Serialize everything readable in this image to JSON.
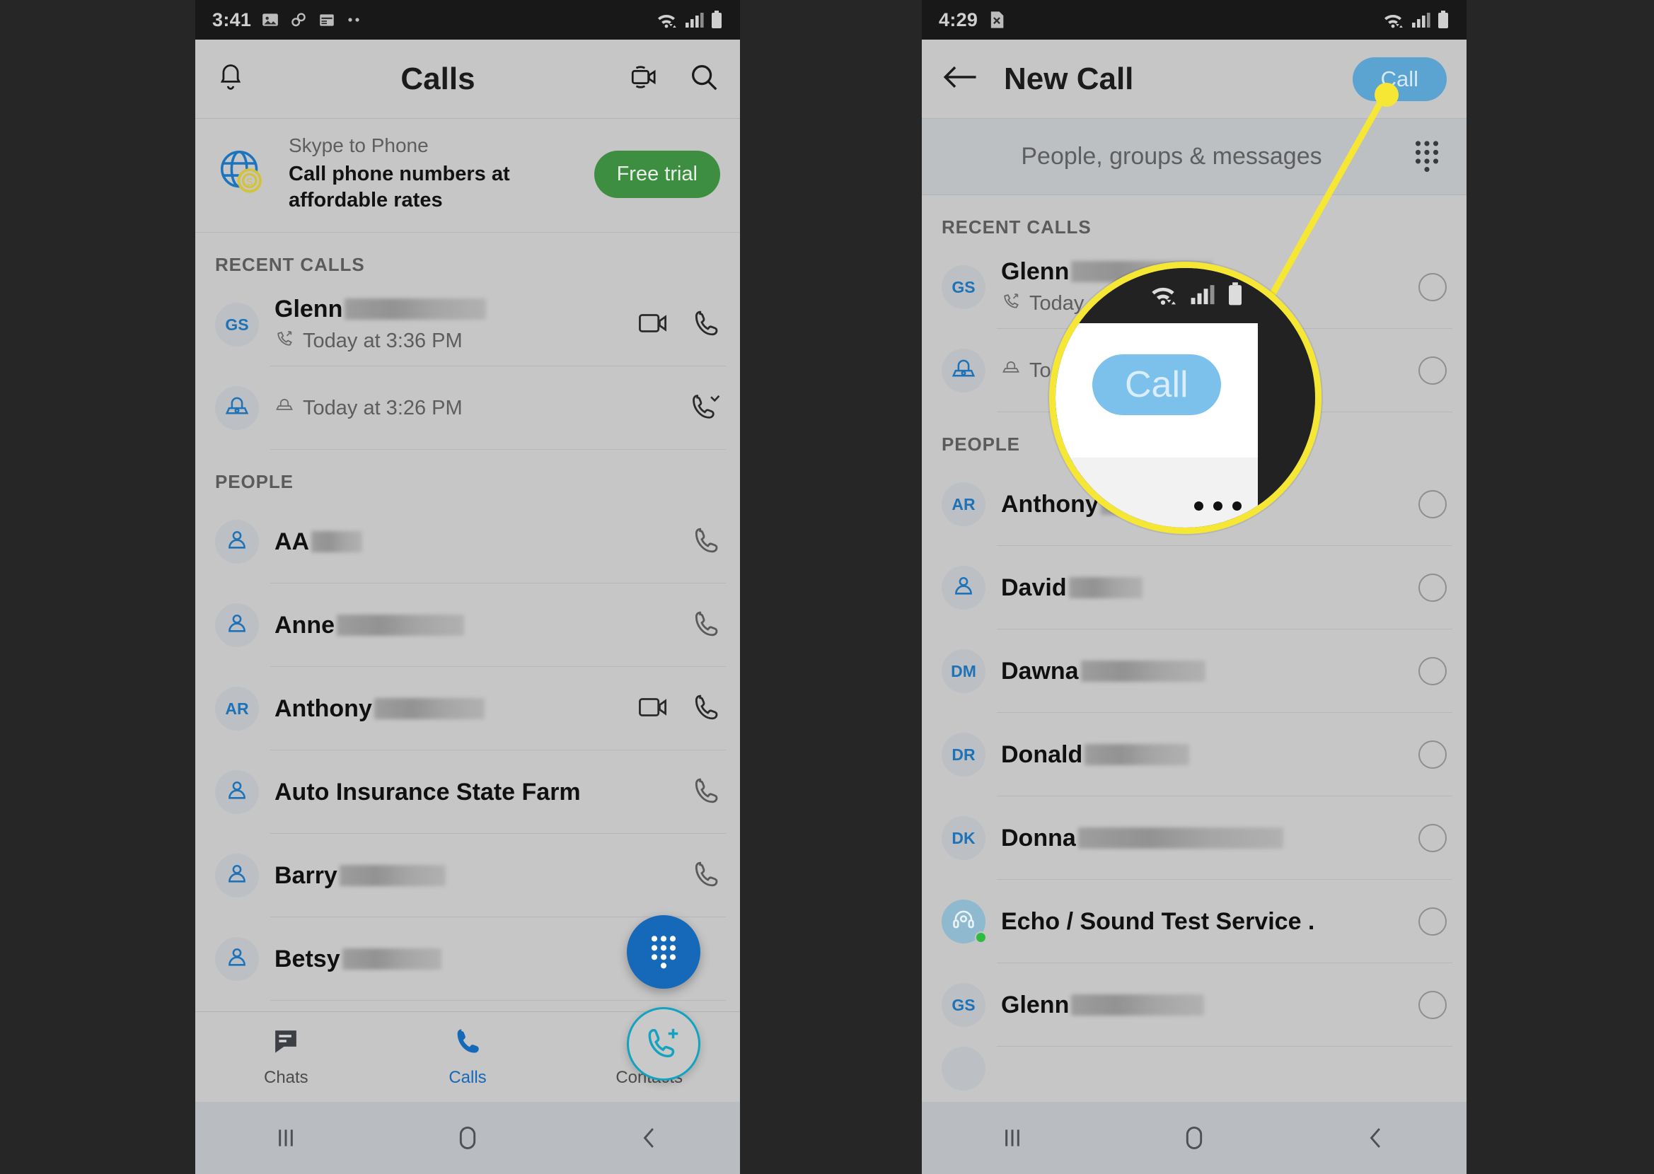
{
  "background_color": "#262626",
  "left_phone": {
    "status_bar": {
      "time": "3:41",
      "icons": [
        "photo-icon",
        "link-icon",
        "calendar-icon",
        "more-dots-icon",
        "wifi-icon",
        "signal-icon",
        "battery-icon"
      ]
    },
    "app_bar": {
      "title": "Calls",
      "bell_icon": "bell-icon",
      "video_icon": "video-camera-icon",
      "search_icon": "search-icon"
    },
    "promo": {
      "kicker": "Skype to Phone",
      "headline": "Call phone numbers at affordable rates",
      "button_label": "Free trial",
      "icon": "globe-coin-icon",
      "button_color": "#3e8e41"
    },
    "recent_calls": {
      "header": "RECENT CALLS",
      "items": [
        {
          "initials": "GS",
          "name": "Glenn",
          "redacted_width": 120,
          "subtitle": "Today at 3:36 PM",
          "call_direction_icon": "outgoing-call-icon",
          "actions": [
            "video-call-icon",
            "phone-call-icon"
          ]
        },
        {
          "initials": "",
          "avatar_icon": "landline-phone-icon",
          "name": "",
          "redacted_width": 0,
          "subtitle": "Today at 3:26 PM",
          "call_direction_icon": "landline-icon",
          "actions": [
            "call-back-icon"
          ]
        }
      ]
    },
    "people": {
      "header": "PEOPLE",
      "items": [
        {
          "initials": "AA",
          "avatar_icon": "",
          "name": "AA",
          "redacted_width": 62,
          "actions": [
            "phone-call-icon"
          ]
        },
        {
          "initials": "",
          "avatar_icon": "person-icon",
          "name": "Anne",
          "redacted_width": 152,
          "actions": [
            "phone-call-icon"
          ]
        },
        {
          "initials": "AR",
          "avatar_icon": "",
          "name": "Anthony",
          "redacted_width": 120,
          "actions": [
            "video-call-icon",
            "phone-call-icon"
          ]
        },
        {
          "initials": "",
          "avatar_icon": "person-icon",
          "name": "Auto Insurance State Farm",
          "redacted_width": 0,
          "actions": [
            "phone-call-icon"
          ]
        },
        {
          "initials": "",
          "avatar_icon": "person-icon",
          "name": "Barry",
          "redacted_width": 128,
          "actions": [
            "phone-call-icon"
          ]
        },
        {
          "initials": "",
          "avatar_icon": "person-icon",
          "name": "Betsy",
          "redacted_width": 120,
          "actions": []
        }
      ]
    },
    "fabs": {
      "dialpad": {
        "icon": "dialpad-icon",
        "color": "#1668b8"
      },
      "new_call": {
        "icon": "phone-plus-icon",
        "color": "#13a2c0"
      }
    },
    "tabs": [
      {
        "label": "Chats",
        "icon": "chat-bubble-icon",
        "active": false
      },
      {
        "label": "Calls",
        "icon": "phone-icon",
        "active": true
      },
      {
        "label": "Contacts",
        "icon": "contacts-book-icon",
        "active": false
      }
    ],
    "nav": [
      "recents-icon",
      "home-icon",
      "back-icon"
    ]
  },
  "right_phone": {
    "status_bar": {
      "time": "4:29",
      "icons": [
        "sim-x-icon",
        "wifi-icon",
        "signal-icon",
        "battery-icon"
      ]
    },
    "app_bar": {
      "back_icon": "back-arrow-icon",
      "title": "New Call",
      "call_button_label": "Call",
      "call_button_color": "#5ba3d0"
    },
    "search": {
      "placeholder": "People, groups & messages",
      "dialpad_icon": "dialpad-icon"
    },
    "recent_calls": {
      "header": "RECENT CALLS",
      "items": [
        {
          "initials": "GS",
          "name": "Glenn",
          "redacted_width": 120,
          "subtitle": "Today",
          "call_direction_icon": "outgoing-call-icon"
        },
        {
          "initials": "",
          "avatar_icon": "landline-phone-icon",
          "name": "",
          "redacted_width": 0,
          "subtitle": "Tod",
          "call_direction_icon": "landline-icon"
        }
      ]
    },
    "people": {
      "header": "PEOPLE",
      "items": [
        {
          "initials": "AR",
          "avatar_icon": "",
          "name": "Anthony",
          "redacted_width": 118
        },
        {
          "initials": "",
          "avatar_icon": "person-icon",
          "name": "David",
          "redacted_width": 98
        },
        {
          "initials": "DM",
          "avatar_icon": "",
          "name": "Dawna",
          "redacted_width": 128
        },
        {
          "initials": "DR",
          "avatar_icon": "",
          "name": "Donald",
          "redacted_width": 140
        },
        {
          "initials": "DK",
          "avatar_icon": "",
          "name": "Donna",
          "redacted_width": 288
        },
        {
          "initials": "",
          "avatar_icon": "echo-headset-icon",
          "name": "Echo / Sound Test Service .",
          "redacted_width": 0,
          "presence": "online"
        },
        {
          "initials": "GS",
          "avatar_icon": "",
          "name": "Glenn",
          "redacted_width": 148
        }
      ]
    },
    "nav": [
      "recents-icon",
      "home-icon",
      "back-icon"
    ]
  },
  "callout": {
    "highlight_color": "#f5e733",
    "call_button_label": "Call",
    "call_button_color": "#7cc1ec",
    "status_icons": [
      "wifi-icon",
      "signal-icon",
      "battery-icon"
    ],
    "more_dots_icon": "more-dots-icon"
  }
}
